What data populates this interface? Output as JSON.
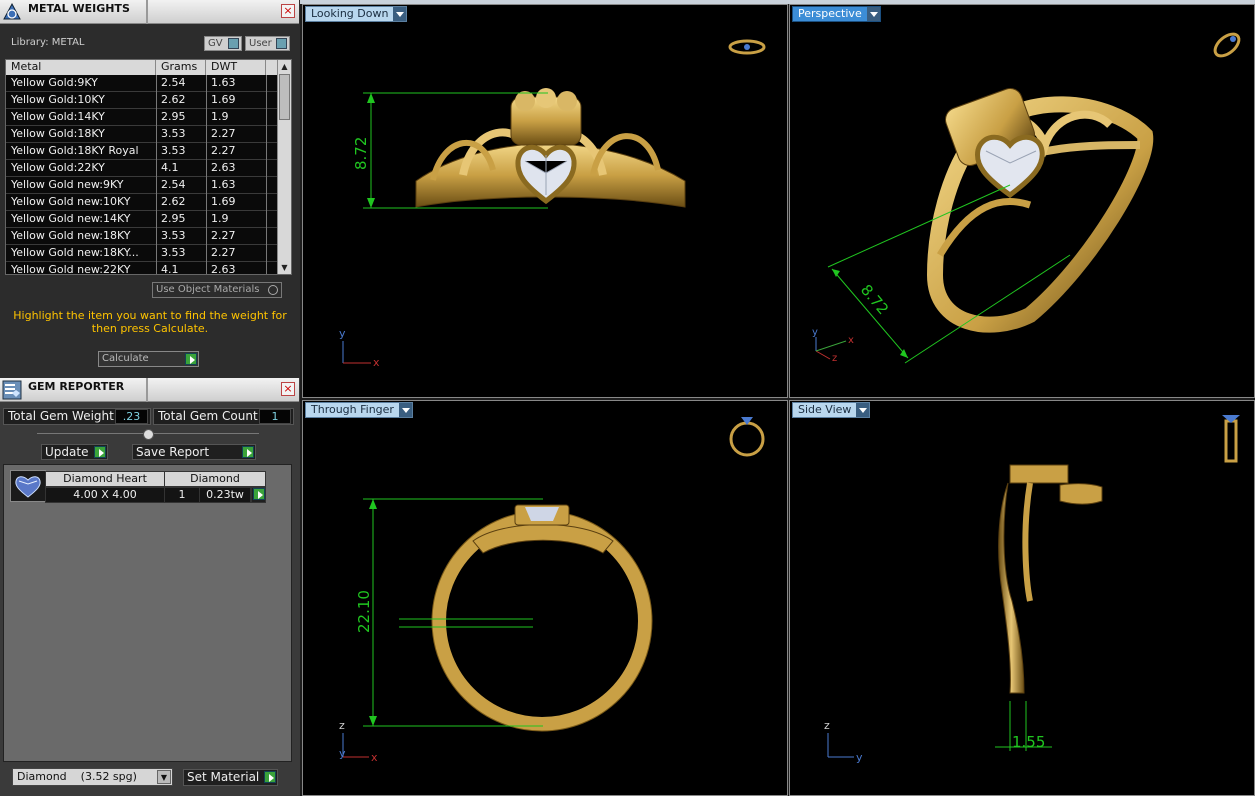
{
  "metal_weights": {
    "title": "METAL WEIGHTS",
    "library_label": "Library: METAL",
    "gv_label": "GV",
    "user_label": "User",
    "columns": [
      "Metal",
      "Grams",
      "DWT"
    ],
    "rows": [
      {
        "metal": "Yellow Gold:9KY",
        "grams": "2.54",
        "dwt": "1.63"
      },
      {
        "metal": "Yellow Gold:10KY",
        "grams": "2.62",
        "dwt": "1.69"
      },
      {
        "metal": "Yellow Gold:14KY",
        "grams": "2.95",
        "dwt": "1.9"
      },
      {
        "metal": "Yellow Gold:18KY",
        "grams": "3.53",
        "dwt": "2.27"
      },
      {
        "metal": "Yellow Gold:18KY Royal",
        "grams": "3.53",
        "dwt": "2.27"
      },
      {
        "metal": "Yellow Gold:22KY",
        "grams": "4.1",
        "dwt": "2.63"
      },
      {
        "metal": "Yellow Gold new:9KY",
        "grams": "2.54",
        "dwt": "1.63"
      },
      {
        "metal": "Yellow Gold new:10KY",
        "grams": "2.62",
        "dwt": "1.69"
      },
      {
        "metal": "Yellow Gold new:14KY",
        "grams": "2.95",
        "dwt": "1.9"
      },
      {
        "metal": "Yellow Gold new:18KY",
        "grams": "3.53",
        "dwt": "2.27"
      },
      {
        "metal": "Yellow Gold new:18KY...",
        "grams": "3.53",
        "dwt": "2.27"
      },
      {
        "metal": "Yellow Gold new:22KY",
        "grams": "4.1",
        "dwt": "2.63"
      }
    ],
    "use_object_materials": "Use Object Materials",
    "hint": "Highlight the item you want to find the weight for then press Calculate.",
    "calculate": "Calculate"
  },
  "gem_reporter": {
    "title": "GEM REPORTER",
    "total_weight_label": "Total Gem Weight",
    "total_weight_value": ".23",
    "total_count_label": "Total Gem Count",
    "total_count_value": "1",
    "update": "Update",
    "save_report": "Save Report",
    "gem": {
      "shape": "Diamond Heart",
      "type": "Diamond",
      "size": "4.00 X 4.00",
      "count": "1",
      "weight": "0.23tw"
    },
    "material_select": "Diamond    (3.52 spg)",
    "set_material": "Set Material"
  },
  "viewports": {
    "top_left": {
      "label": "Looking Down",
      "dimension": "8.72"
    },
    "top_right": {
      "label": "Perspective",
      "dimension": "8.72"
    },
    "bottom_left": {
      "label": "Through Finger",
      "dimension": "22.10"
    },
    "bottom_right": {
      "label": "Side View",
      "dimension": "1.55"
    }
  },
  "axes": {
    "x": "x",
    "y": "y",
    "z": "z"
  },
  "colors": {
    "accent": "#3c8dd6",
    "dimension": "#20c520",
    "hint": "#ffc400",
    "gold": "#c9a045"
  }
}
